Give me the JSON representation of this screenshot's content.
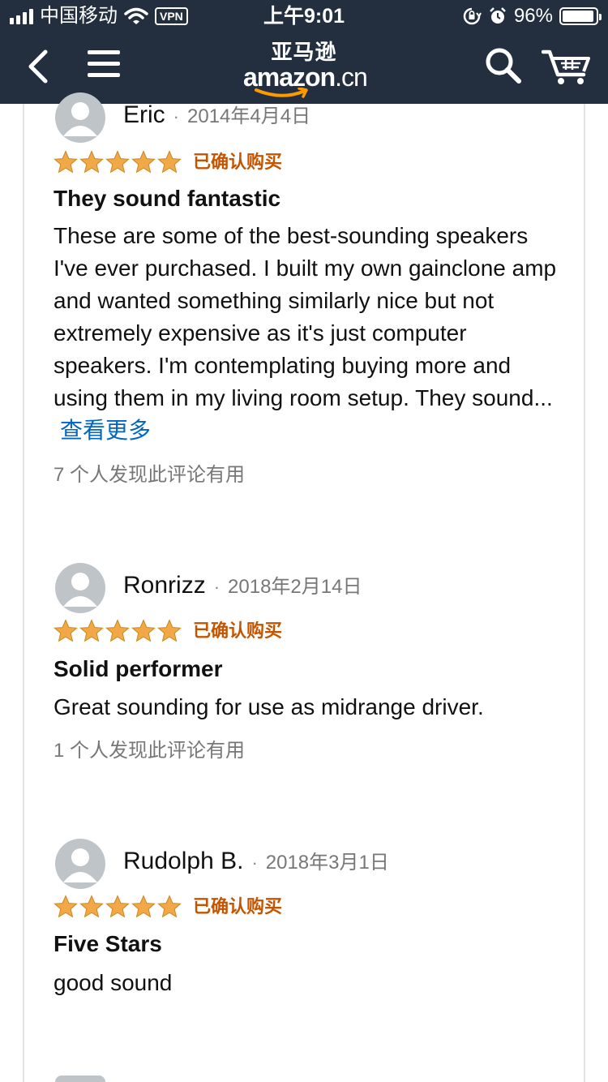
{
  "status_bar": {
    "carrier": "中国移动",
    "vpn": "VPN",
    "time": "上午9:01",
    "battery": "96%",
    "battery_level": 0.96
  },
  "nav": {
    "logo_cn": "亚马逊",
    "logo_en": "amazon",
    "logo_tld": ".cn"
  },
  "colors": {
    "header_bg": "#232f3e",
    "star": "#f3a847",
    "verified": "#c45500",
    "link": "#0066c0",
    "logo_smile": "#ff9900"
  },
  "reviews": [
    {
      "author": "Eric",
      "date": "2014年4月4日",
      "rating": 5,
      "verified": "已确认购买",
      "title": "They sound fantastic",
      "body": "These are some of the best-sounding speakers I've ever purchased. I built my own gainclone amp and wanted something similarly nice but not extremely expensive as it's just computer speakers. I'm contemplating buying more and using them in my living room setup. They sound...",
      "more": "查看更多",
      "helpful": "7 个人发现此评论有用"
    },
    {
      "author": "Ronrizz",
      "date": "2018年2月14日",
      "rating": 5,
      "verified": "已确认购买",
      "title": "Solid performer",
      "body": "Great sounding for use as midrange driver.",
      "helpful": "1 个人发现此评论有用"
    },
    {
      "author": "Rudolph B.",
      "date": "2018年3月1日",
      "rating": 5,
      "verified": "已确认购买",
      "title": "Five Stars",
      "body": "good sound"
    }
  ]
}
